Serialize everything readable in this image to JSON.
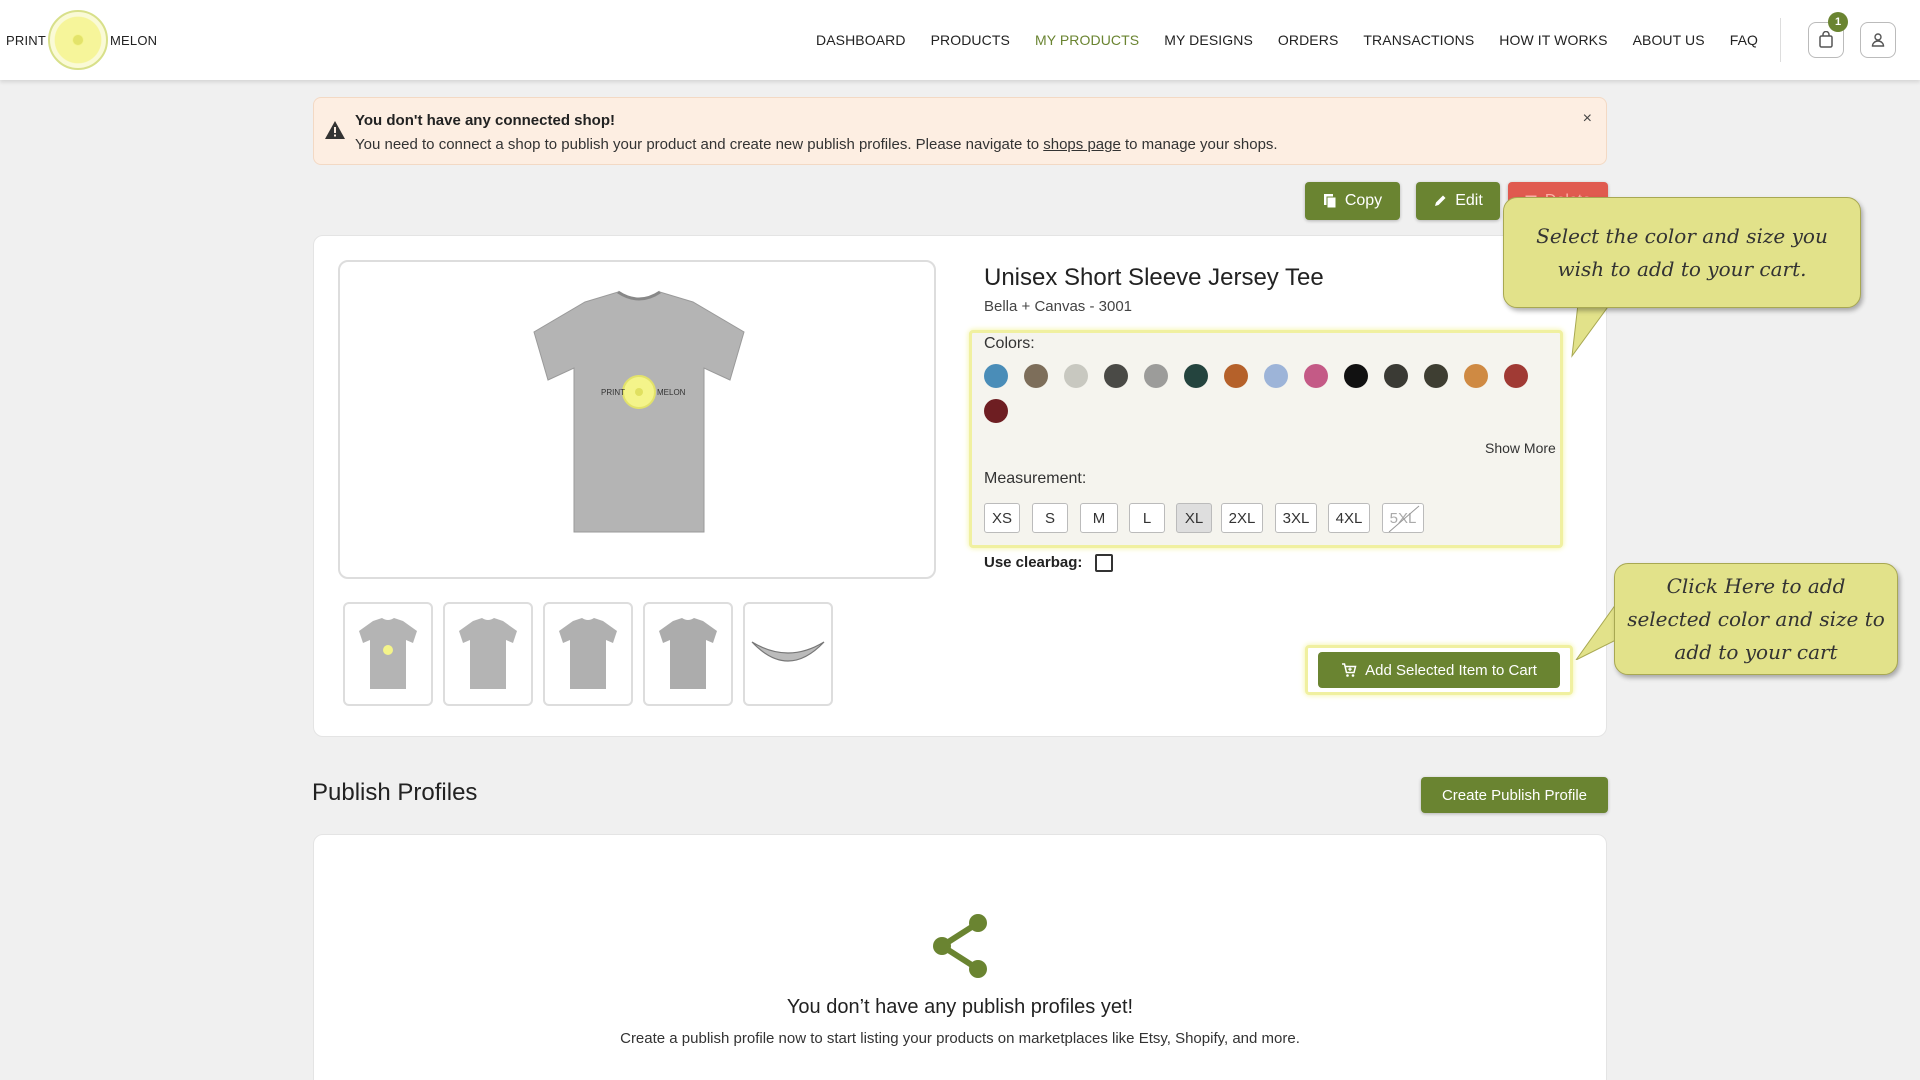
{
  "brand": {
    "left_word": "PRINT",
    "right_word": "MELON"
  },
  "nav": {
    "items": [
      {
        "label": "DASHBOARD"
      },
      {
        "label": "PRODUCTS"
      },
      {
        "label": "MY PRODUCTS",
        "active": true
      },
      {
        "label": "MY DESIGNS"
      },
      {
        "label": "ORDERS"
      },
      {
        "label": "TRANSACTIONS"
      },
      {
        "label": "HOW IT WORKS"
      },
      {
        "label": "ABOUT US"
      },
      {
        "label": "FAQ"
      }
    ],
    "cart_count": "1",
    "cart_icon": "shopping-bag-icon",
    "user_icon": "user-icon"
  },
  "alert": {
    "title": "You don't have any connected shop!",
    "message_before": "You need to connect a shop to publish your product and create new publish profiles. Please navigate to ",
    "link": "shops page",
    "message_after": " to manage your shops.",
    "close": "×"
  },
  "actions": {
    "copy": "Copy",
    "edit": "Edit",
    "delete": "Delete"
  },
  "product": {
    "title": "Unisex Short Sleeve Jersey Tee",
    "subtitle": "Bella + Canvas - 3001",
    "colors_label": "Colors:",
    "colors": [
      "#4a8db8",
      "#7d6e5a",
      "#c8c8c0",
      "#4a4a46",
      "#9c9c9a",
      "#24443e",
      "#b5612a",
      "#9db4d8",
      "#c45a86",
      "#111111",
      "#3a3a34",
      "#3e3e32",
      "#cf8a43",
      "#a03a34",
      "#6e1e22"
    ],
    "show_more": "Show More",
    "measurement_label": "Measurement:",
    "sizes": [
      "XS",
      "S",
      "M",
      "L",
      "XL",
      "2XL",
      "3XL",
      "4XL",
      "5XL"
    ],
    "selected_size": "XL",
    "unavailable_size": "5XL",
    "clearbag_label": "Use clearbag:",
    "clearbag_checked": false,
    "add_to_cart": "Add Selected Item to Cart"
  },
  "tooltips": {
    "select": "Select the color and size you wish to add to your cart.",
    "cart": "Click Here to add selected color and size to add to your cart"
  },
  "publish": {
    "heading": "Publish Profiles",
    "create_button": "Create Publish Profile",
    "empty_title": "You don’t have any publish profiles yet!",
    "empty_desc": "Create a publish profile now to start listing your products on marketplaces like Etsy, Shopify, and more."
  },
  "colors": {
    "accent": "#6a8431",
    "danger": "#e05a4f",
    "alert_bg": "#fdeee2",
    "tooltip_bg": "#e2e28a"
  }
}
